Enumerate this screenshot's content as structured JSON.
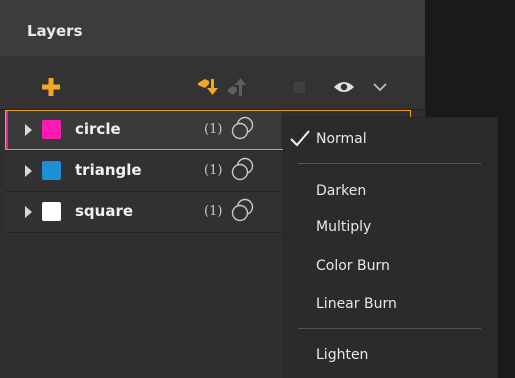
{
  "panel": {
    "title": "Layers"
  },
  "toolbar": {
    "icons": [
      {
        "name": "add-layer-icon",
        "color": "#f5a623"
      },
      {
        "name": "move-down-icon",
        "color": "#f5a623"
      },
      {
        "name": "move-up-icon",
        "color": "#666666"
      },
      {
        "name": "square-icon",
        "color": "#3f3f3f"
      },
      {
        "name": "visibility-eye-icon",
        "color": "#e0e0e0"
      },
      {
        "name": "chevron-down-icon",
        "color": "#bdbdbd"
      }
    ]
  },
  "layers": [
    {
      "name": "circle",
      "count": "(1)",
      "swatch": "#ff1ab3",
      "selected": true
    },
    {
      "name": "triangle",
      "count": "(1)",
      "swatch": "#1e8fd6",
      "selected": false
    },
    {
      "name": "square",
      "count": "(1)",
      "swatch": "#ffffff",
      "selected": false
    }
  ],
  "blend_menu": {
    "selected": "Normal",
    "items": [
      "Normal",
      "Darken",
      "Multiply",
      "Color Burn",
      "Linear Burn",
      "Lighten"
    ]
  },
  "colors": {
    "accent": "#f5a623",
    "selection_border": "#f0a030",
    "selected_edge": "#e22a8a"
  }
}
